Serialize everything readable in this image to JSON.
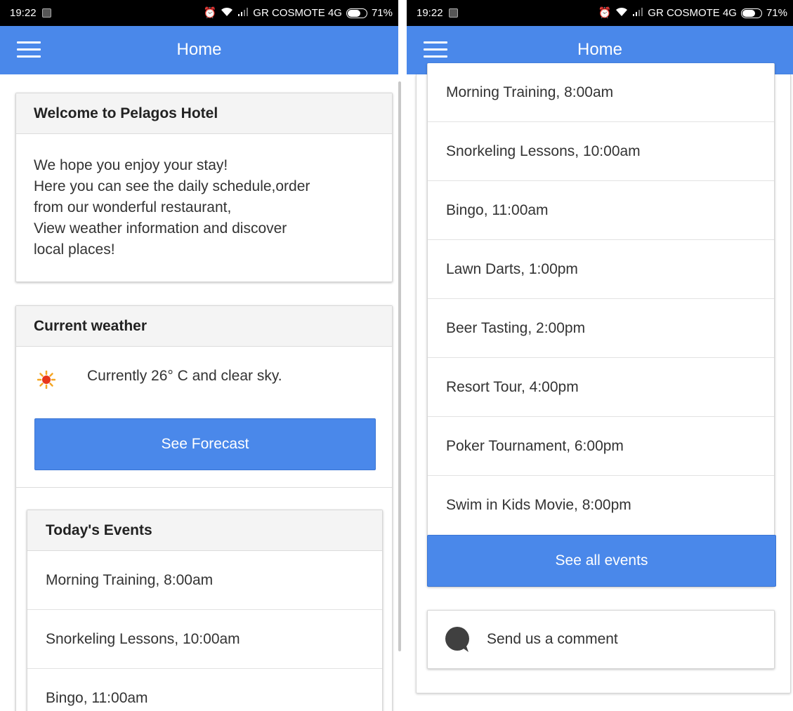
{
  "status_bar": {
    "time": "19:22",
    "carrier": "GR COSMOTE 4G",
    "battery_percent": "71%",
    "battery_level": 0.71,
    "alarm_icon": "alarm-clock-icon",
    "wifi_icon": "wifi-icon",
    "signal_icon": "signal-bars-icon"
  },
  "app_bar": {
    "title": "Home",
    "menu_icon": "hamburger-menu-icon",
    "color": "#4a88ea"
  },
  "welcome": {
    "title": "Welcome to Pelagos Hotel",
    "lines": [
      "We hope you enjoy your stay!",
      "Here you can see the daily schedule,order",
      "from our wonderful restaurant,",
      "View weather information and discover",
      "local places!"
    ]
  },
  "weather": {
    "title": "Current weather",
    "text": "Currently 26° C and clear sky.",
    "icon": "sun-icon",
    "button_label": "See Forecast"
  },
  "events": {
    "title": "Today's Events",
    "items": [
      "Morning Training, 8:00am",
      "Snorkeling Lessons, 10:00am",
      "Bingo, 11:00am",
      "Lawn Darts, 1:00pm",
      "Beer Tasting, 2:00pm",
      "Resort Tour, 4:00pm",
      "Poker Tournament, 6:00pm",
      "Swim in Kids Movie, 8:00pm"
    ],
    "see_all_label": "See all events"
  },
  "comment": {
    "label": "Send us a comment",
    "icon": "speech-bubble-icon"
  }
}
